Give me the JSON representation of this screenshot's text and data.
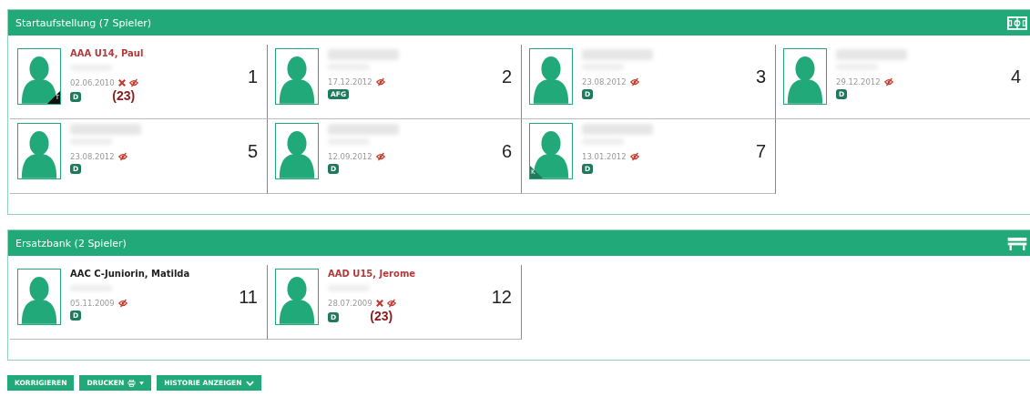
{
  "sections": [
    {
      "title": "Startaufstellung (7 Spieler)",
      "kind": "field",
      "players": [
        {
          "name": "AAA U14, Paul",
          "flagged": true,
          "details_blurred": true,
          "birthdate": "02.06.2010",
          "crossed": true,
          "badge": "D",
          "note": "(23)",
          "corner": "T",
          "number": "1"
        },
        {
          "details_blurred": true,
          "birthdate": "17.12.2012",
          "crossed": false,
          "badge": "AFG",
          "number": "2"
        },
        {
          "details_blurred": true,
          "birthdate": "23.08.2012",
          "crossed": false,
          "badge": "D",
          "number": "3"
        },
        {
          "details_blurred": true,
          "birthdate": "29.12.2012",
          "crossed": false,
          "badge": "D",
          "number": "4"
        },
        {
          "details_blurred": true,
          "birthdate": "23.08.2012",
          "crossed": false,
          "badge": "D",
          "number": "5"
        },
        {
          "details_blurred": true,
          "birthdate": "12.09.2012",
          "crossed": false,
          "badge": "D",
          "number": "6"
        },
        {
          "details_blurred": true,
          "birthdate": "13.01.2012",
          "crossed": false,
          "badge": "D",
          "corner": "K",
          "number": "7"
        }
      ]
    },
    {
      "title": "Ersatzbank (2 Spieler)",
      "kind": "bench",
      "players": [
        {
          "name": "AAC C-Juniorin, Matilda",
          "flagged": false,
          "details_blurred": true,
          "birthdate": "05.11.2009",
          "crossed": false,
          "badge": "D",
          "number": "11"
        },
        {
          "name": "AAD U15, Jerome",
          "flagged": true,
          "details_blurred": true,
          "birthdate": "28.07.2009",
          "crossed": true,
          "badge": "D",
          "note": "(23)",
          "number": "12"
        }
      ]
    }
  ],
  "buttons": [
    {
      "label": "KORRIGIEREN",
      "kind": "plain"
    },
    {
      "label": "DRUCKEN",
      "kind": "print"
    },
    {
      "label": "HISTORIE ANZEIGEN",
      "kind": "expand"
    }
  ]
}
